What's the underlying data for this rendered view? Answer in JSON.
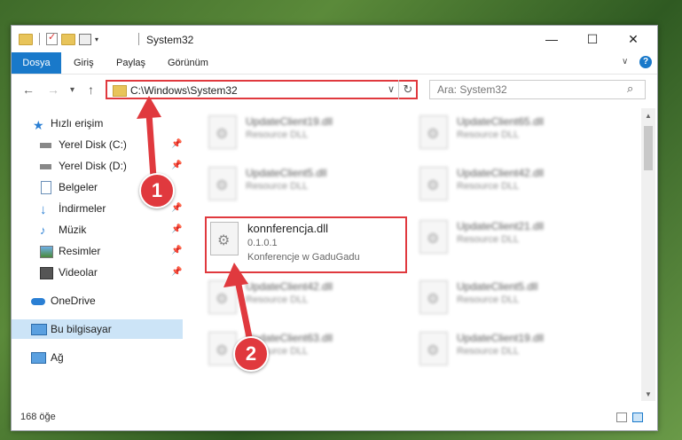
{
  "window": {
    "title": "System32"
  },
  "ribbon": {
    "tabs": [
      "Dosya",
      "Giriş",
      "Paylaş",
      "Görünüm"
    ],
    "help": "?"
  },
  "nav": {
    "back": "←",
    "forward": "→",
    "recent": "▾",
    "up": "↑",
    "address": "C:\\Windows\\System32",
    "refresh": "↻",
    "search_placeholder": "Ara: System32"
  },
  "sidebar": {
    "items": [
      {
        "label": "Hızlı erişim",
        "icon": "star-icon"
      },
      {
        "label": "Yerel Disk (C:)",
        "icon": "drive-icon"
      },
      {
        "label": "Yerel Disk (D:)",
        "icon": "drive-icon"
      },
      {
        "label": "Belgeler",
        "icon": "document-icon"
      },
      {
        "label": "İndirmeler",
        "icon": "download-icon"
      },
      {
        "label": "Müzik",
        "icon": "music-icon"
      },
      {
        "label": "Resimler",
        "icon": "pictures-icon"
      },
      {
        "label": "Videolar",
        "icon": "video-icon"
      },
      {
        "label": "OneDrive",
        "icon": "cloud-icon"
      },
      {
        "label": "Bu bilgisayar",
        "icon": "computer-icon"
      },
      {
        "label": "Ağ",
        "icon": "network-icon"
      }
    ]
  },
  "files": [
    {
      "name": "UpdateClient19.dll",
      "desc": "Resource DLL"
    },
    {
      "name": "UpdateClient65.dll",
      "desc": "Resource DLL"
    },
    {
      "name": "UpdateClient5.dll",
      "desc": "Resource DLL"
    },
    {
      "name": "UpdateClient42.dll",
      "desc": "Resource DLL"
    },
    {
      "name": "konnferencja.dll",
      "version": "0.1.0.1",
      "desc": "Konferencje w GaduGadu"
    },
    {
      "name": "UpdateClient21.dll",
      "desc": "Resource DLL"
    },
    {
      "name": "UpdateClient42.dll",
      "desc": "Resource DLL"
    },
    {
      "name": "UpdateClient5.dll",
      "desc": "Resource DLL"
    },
    {
      "name": "UpdateClient63.dll",
      "desc": "Resource DLL"
    },
    {
      "name": "UpdateClient19.dll",
      "desc": "Resource DLL"
    }
  ],
  "status": {
    "count": "168 öğe"
  },
  "annotations": {
    "step1": "1",
    "step2": "2",
    "color": "#e0393e"
  }
}
